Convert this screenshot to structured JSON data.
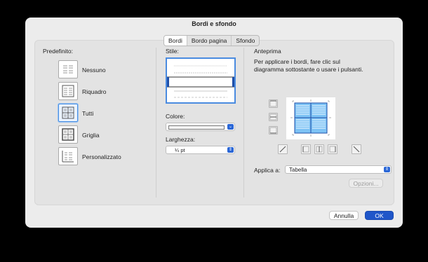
{
  "window": {
    "title": "Bordi e sfondo"
  },
  "tabs": [
    {
      "label": "Bordi",
      "active": true
    },
    {
      "label": "Bordo pagina",
      "active": false
    },
    {
      "label": "Sfondo",
      "active": false
    }
  ],
  "predefinito": {
    "heading": "Predefinito:",
    "items": [
      {
        "label": "Nessuno",
        "icon": "preset-none-icon"
      },
      {
        "label": "Riquadro",
        "icon": "preset-box-icon"
      },
      {
        "label": "Tutti",
        "icon": "preset-all-icon",
        "selected": true
      },
      {
        "label": "Griglia",
        "icon": "preset-grid-icon"
      },
      {
        "label": "Personalizzato",
        "icon": "preset-custom-icon"
      }
    ]
  },
  "stile": {
    "heading": "Stile:",
    "colore_label": "Colore:",
    "larghezza_label": "Larghezza:",
    "larghezza_value": "¼ pt"
  },
  "anteprima": {
    "heading": "Anteprima",
    "instructions": "Per applicare i bordi, fare clic sul diagramma sottostante o usare i pulsanti.",
    "applica_label": "Applica a:",
    "applica_value": "Tabella",
    "opzioni_label": "Opzioni..."
  },
  "footer": {
    "cancel_label": "Annulla",
    "ok_label": "OK"
  },
  "colors": {
    "accent": "#2b67d6",
    "preview_fill": "#7ec3f5",
    "selection": "#4a90e2"
  }
}
